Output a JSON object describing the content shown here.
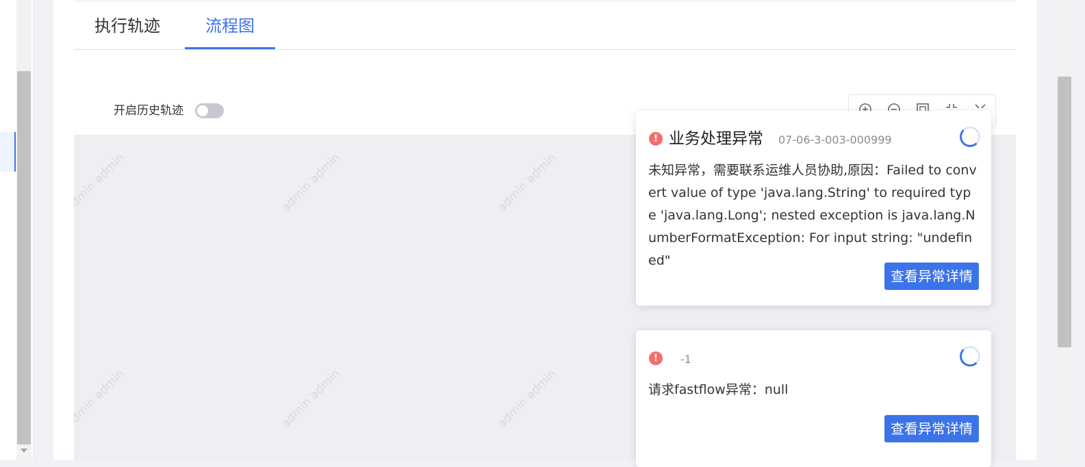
{
  "tabs": [
    {
      "label": "执行轨迹",
      "active": false
    },
    {
      "label": "流程图",
      "active": true
    }
  ],
  "history_toggle": {
    "label": "开启历史轨迹",
    "enabled": false
  },
  "watermark_text": "admin admin",
  "toolbar": {
    "icons": [
      "zoom-in-icon",
      "zoom-out-icon",
      "fit-screen-icon",
      "center-icon",
      "fullscreen-icon"
    ]
  },
  "colors": {
    "accent": "#3b73e8",
    "error": "#f56c6c"
  },
  "errors": [
    {
      "title": "业务处理异常",
      "code": "07-06-3-003-000999",
      "message": "未知异常，需要联系运维人员协助,原因：Failed to convert value of type 'java.lang.String' to required type 'java.lang.Long'; nested exception is java.lang.NumberFormatException: For input string: \"undefined\"",
      "button_label": "查看异常详情"
    },
    {
      "title": "",
      "code": "-1",
      "message": "请求fastflow异常：null",
      "button_label": "查看异常详情"
    }
  ]
}
